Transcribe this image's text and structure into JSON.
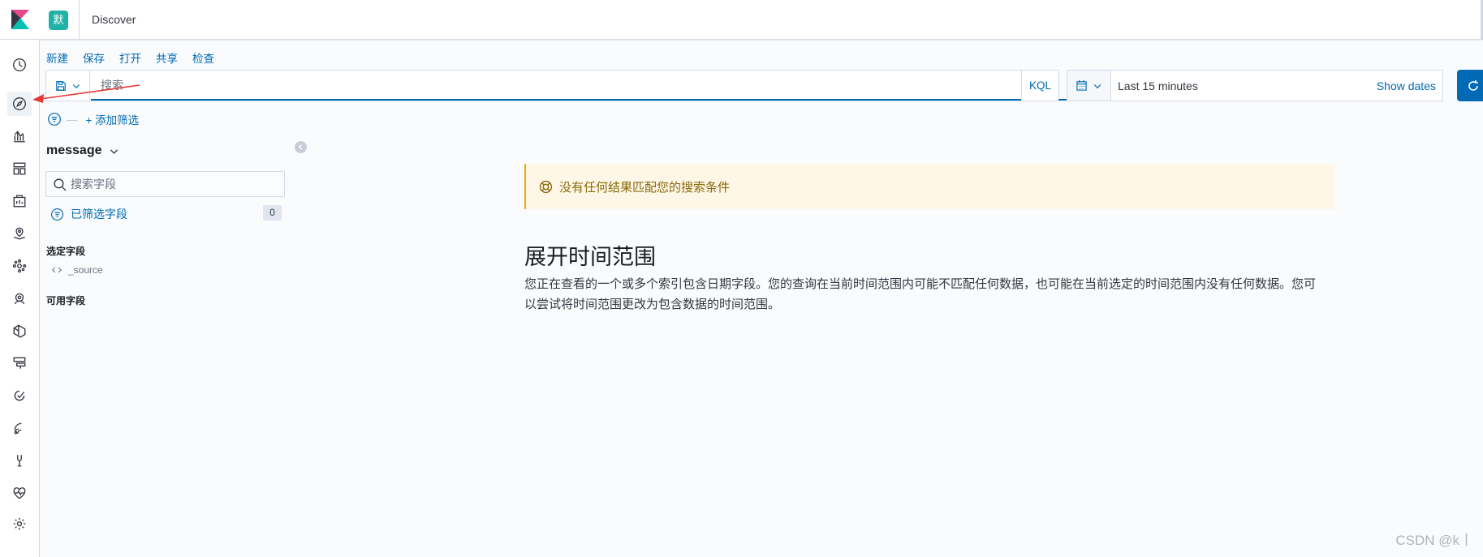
{
  "header": {
    "space_initial": "默",
    "breadcrumb": "Discover"
  },
  "top_menu": [
    "新建",
    "保存",
    "打开",
    "共享",
    "检查"
  ],
  "query": {
    "placeholder": "搜索",
    "language": "KQL"
  },
  "time": {
    "range": "Last 15 minutes",
    "show_dates": "Show dates"
  },
  "filter": {
    "dash": "—",
    "add_filter": "+ 添加筛选"
  },
  "sidebar": {
    "index_pattern": "message",
    "field_search_placeholder": "搜索字段",
    "filtered_fields_label": "已筛选字段",
    "filtered_fields_count": "0",
    "selected_fields_title": "选定字段",
    "selected_fields": [
      "_source"
    ],
    "available_fields_title": "可用字段"
  },
  "main": {
    "callout": "没有任何结果匹配您的搜索条件",
    "title": "展开时间范围",
    "description": "您正在查看的一个或多个索引包含日期字段。您的查询在当前时间范围内可能不匹配任何数据，也可能在当前选定的时间范围内没有任何数据。您可以尝试将时间范围更改为包含数据的时间范围。"
  },
  "nav_icons": [
    "clock-icon",
    "compass-icon",
    "visualize-icon",
    "dashboard-icon",
    "canvas-icon",
    "maps-icon",
    "ml-icon",
    "infrastructure-icon",
    "logs-icon",
    "apm-icon",
    "uptime-icon",
    "siem-icon",
    "dev-tools-icon",
    "monitoring-icon",
    "management-icon"
  ],
  "watermark": "CSDN @k丨",
  "colors": {
    "accent": "#006bb4",
    "space_avatar": "#20b2a6",
    "warning_bg": "#fef6e6",
    "warning_border": "#f5a700",
    "annotation_arrow": "#e53935"
  }
}
